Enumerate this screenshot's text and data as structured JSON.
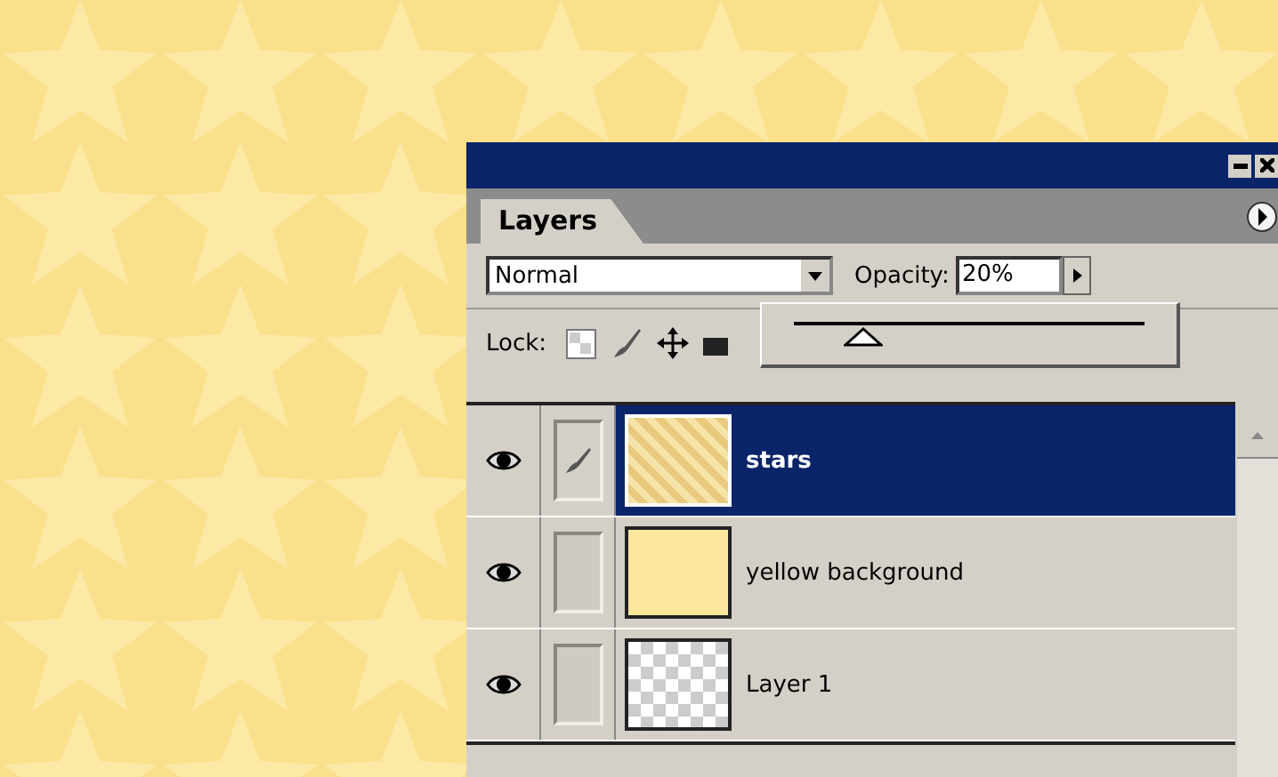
{
  "panel": {
    "tab": {
      "label": "Layers",
      "selected": true
    },
    "blend_mode": {
      "value": "Normal"
    },
    "opacity": {
      "label": "Opacity:",
      "value": "20%",
      "level": 0.2,
      "popup_open": true
    },
    "lock": {
      "label": "Lock:"
    },
    "layers": [
      {
        "name": "stars",
        "visible": true,
        "brush": true,
        "selected": true,
        "kind": "pattern"
      },
      {
        "name": "yellow background",
        "visible": true,
        "brush": false,
        "selected": false,
        "kind": "solid"
      },
      {
        "name": "Layer 1",
        "visible": true,
        "brush": false,
        "selected": false,
        "kind": "transparent"
      }
    ]
  }
}
